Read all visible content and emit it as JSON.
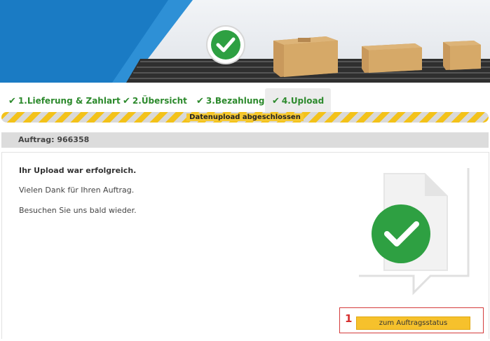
{
  "tabs": [
    {
      "label": "1.Lieferung & Zahlart"
    },
    {
      "label": "2.Übersicht"
    },
    {
      "label": "3.Bezahlung"
    },
    {
      "label": "4.Upload"
    }
  ],
  "progress": {
    "label": "Datenupload abgeschlossen"
  },
  "order": {
    "label": "Auftrag: 966358"
  },
  "message": {
    "title": "Ihr Upload war erfolgreich.",
    "thanks": "Vielen Dank für Ihren Auftrag.",
    "visit": "Besuchen Sie uns bald wieder."
  },
  "annotation": {
    "marker": "1"
  },
  "actions": {
    "status_button": "zum Auftragsstatus"
  },
  "colors": {
    "accent": "#2d8a2d",
    "brand_blue": "#1a7bc4",
    "button": "#f6c12c",
    "highlight": "#d43c3c"
  }
}
